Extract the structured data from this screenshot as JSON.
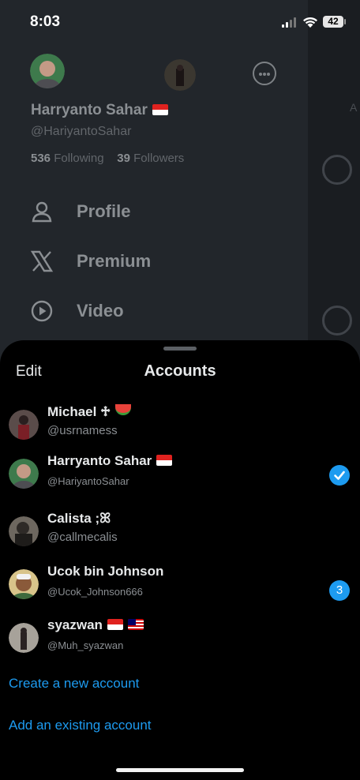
{
  "status_bar": {
    "time": "8:03",
    "battery": "42"
  },
  "drawer": {
    "name": "Harryanto Sahar",
    "handle": "@HariyantoSahar",
    "following_count": "536",
    "following_label": "Following",
    "followers_count": "39",
    "followers_label": "Followers",
    "ghost_tab": "A",
    "menu": [
      {
        "label": "Profile",
        "icon": "person-icon"
      },
      {
        "label": "Premium",
        "icon": "x-logo-icon"
      },
      {
        "label": "Video",
        "icon": "play-circle-icon"
      }
    ]
  },
  "sheet": {
    "edit_label": "Edit",
    "title": "Accounts",
    "accounts": [
      {
        "name": "Michael ♱",
        "handle": "@usrnamess",
        "emoji": "watermelon"
      },
      {
        "name": "Harryanto Sahar",
        "handle": "@HariyantoSahar",
        "flags": [
          "indonesia"
        ],
        "selected": true
      },
      {
        "name": "Calista ;ꕤ",
        "handle": "@callmecalis"
      },
      {
        "name": "Ucok bin Johnson",
        "handle": "@Ucok_Johnson666",
        "badge": "3"
      },
      {
        "name": "syazwan",
        "handle": "@Muh_syazwan",
        "flags": [
          "indonesia",
          "malaysia"
        ]
      }
    ],
    "create_link": "Create a new account",
    "add_link": "Add an existing account"
  },
  "colors": {
    "accent": "#1d9bf0",
    "sheet_bg": "#000000",
    "drawer_bg": "#22262b"
  }
}
